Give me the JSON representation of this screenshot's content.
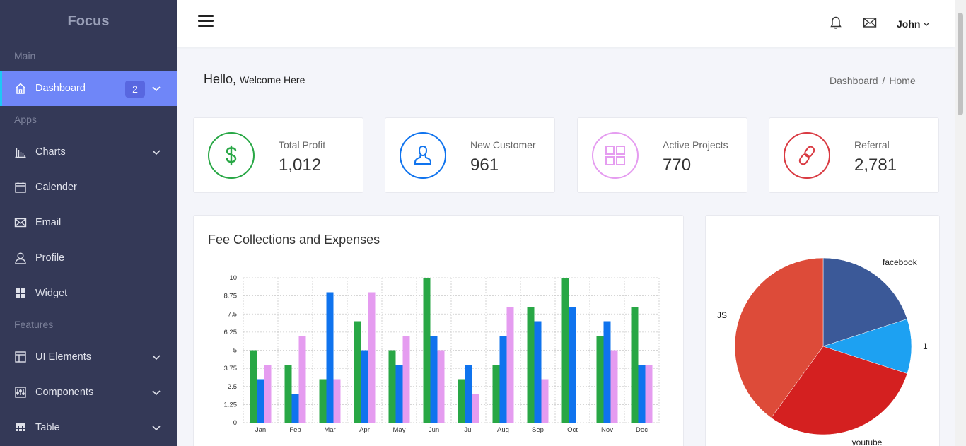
{
  "sidebar": {
    "brand": "Focus",
    "sections": [
      "Main",
      "Apps",
      "Features"
    ],
    "items": [
      {
        "label": "Dashboard",
        "badge": "2"
      },
      {
        "label": "Charts"
      },
      {
        "label": "Calender"
      },
      {
        "label": "Email"
      },
      {
        "label": "Profile"
      },
      {
        "label": "Widget"
      },
      {
        "label": "UI Elements"
      },
      {
        "label": "Components"
      },
      {
        "label": "Table"
      }
    ]
  },
  "header": {
    "user": "John",
    "icons": [
      "menu-icon",
      "bell-icon",
      "mail-icon",
      "chevron-down-icon"
    ]
  },
  "page": {
    "hello": "Hello,",
    "welcome": "Welcome Here",
    "breadcrumb": [
      "Dashboard",
      "Home"
    ]
  },
  "stats": [
    {
      "label": "Total Profit",
      "value": "1,012",
      "icon": "dollar-icon",
      "color": "#28a745"
    },
    {
      "label": "New Customer",
      "value": "961",
      "icon": "user-icon",
      "color": "#0f73ee"
    },
    {
      "label": "Active Projects",
      "value": "770",
      "icon": "grid-icon",
      "color": "#e59cf0"
    },
    {
      "label": "Referral",
      "value": "2,781",
      "icon": "link-icon",
      "color": "#d93a42"
    }
  ],
  "fee_panel": {
    "title": "Fee Collections and Expenses"
  },
  "colors": {
    "sidebar": "#343957",
    "active": "#6f86f8",
    "badge": "#5867e0",
    "accent": "#1ec8f5"
  },
  "chart_data": [
    {
      "type": "bar",
      "title": "Fee Collections and Expenses",
      "categories": [
        "Jan",
        "Feb",
        "Mar",
        "Apr",
        "May",
        "Jun",
        "Jul",
        "Aug",
        "Sep",
        "Oct",
        "Nov",
        "Dec"
      ],
      "series": [
        {
          "values": [
            5,
            4,
            3,
            7,
            5,
            10,
            3,
            4,
            8,
            10,
            6,
            8
          ],
          "color": "#28a745"
        },
        {
          "values": [
            3,
            2,
            9,
            5,
            4,
            6,
            4,
            6,
            7,
            8,
            7,
            4
          ],
          "color": "#0f73ee"
        },
        {
          "values": [
            4,
            6,
            3,
            9,
            6,
            5,
            2,
            8,
            3,
            0,
            5,
            4
          ],
          "color": "#e59cf0"
        }
      ],
      "yticks": [
        "0",
        "1.25",
        "2.5",
        "3.75",
        "5",
        "6.25",
        "7.5",
        "8.75",
        "10"
      ],
      "ylim": [
        0,
        10
      ],
      "grid": true
    },
    {
      "type": "pie",
      "labels": [
        "facebook",
        "1",
        "youtube",
        "JS"
      ],
      "values": [
        20,
        10,
        30,
        40
      ],
      "colors": [
        "#3b5998",
        "#1da1f2",
        "#d42020",
        "#dd4b39"
      ]
    }
  ]
}
